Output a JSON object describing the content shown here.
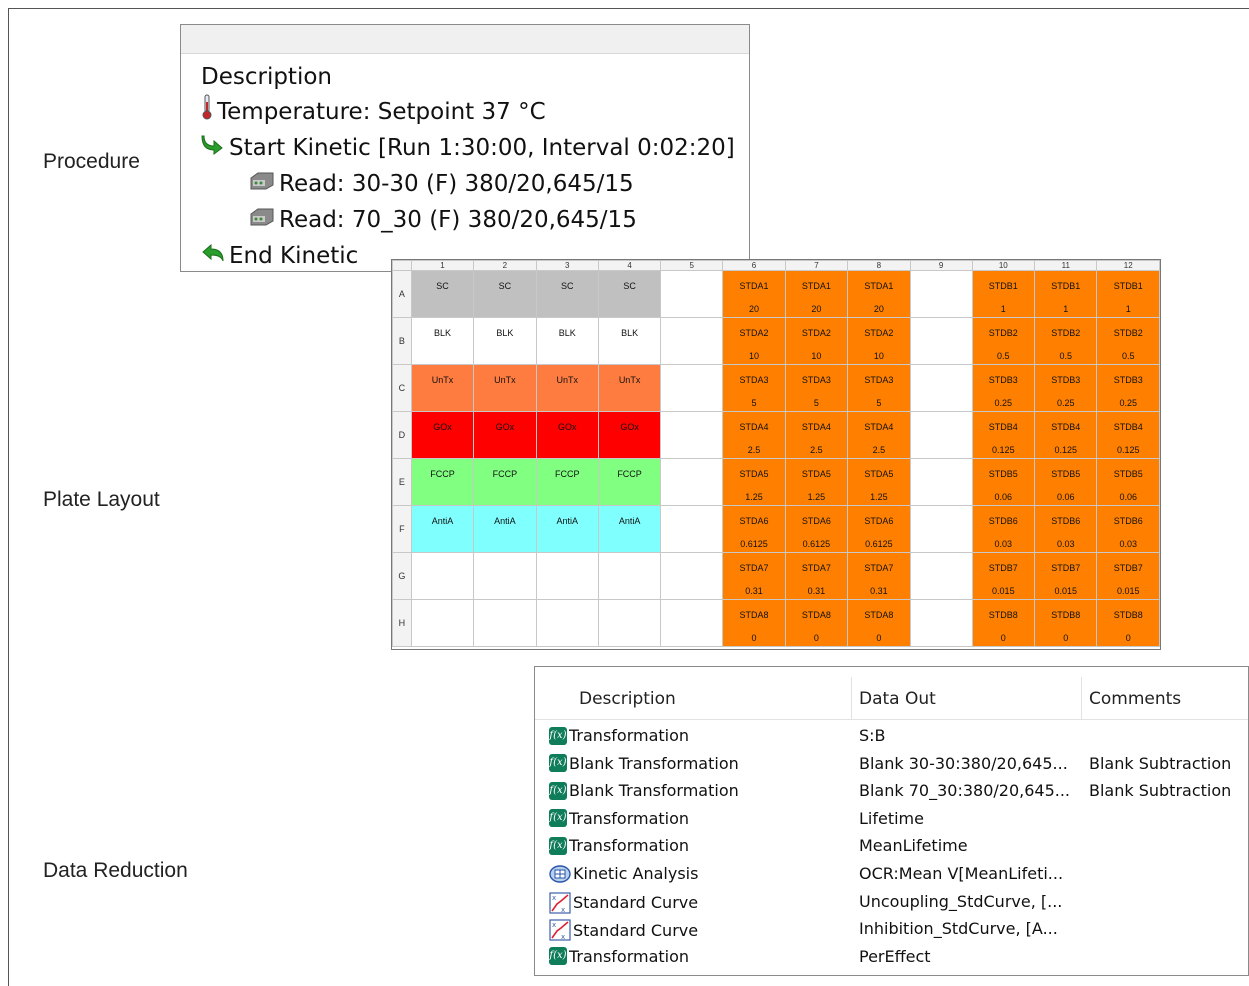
{
  "labels": {
    "procedure": "Procedure",
    "plate_layout": "Plate Layout",
    "data_reduction": "Data Reduction"
  },
  "procedure": {
    "header": "Description",
    "lines": [
      {
        "icon": "thermometer-icon",
        "text": "Temperature:  Setpoint 37 °C"
      },
      {
        "icon": "green-arrow-right-icon",
        "text": "Start Kinetic [Run 1:30:00, Interval 0:02:20]"
      },
      {
        "icon": "plate-reader-icon",
        "text": "Read:  30-30 (F) 380/20,645/15"
      },
      {
        "icon": "plate-reader-icon",
        "text": "Read:  70_30 (F) 380/20,645/15"
      },
      {
        "icon": "green-arrow-back-icon",
        "text": "End Kinetic"
      }
    ]
  },
  "plate": {
    "columns": [
      "1",
      "2",
      "3",
      "4",
      "5",
      "6",
      "7",
      "8",
      "9",
      "10",
      "11",
      "12"
    ],
    "colors": {
      "gray": "#c0c0c0",
      "white": "#ffffff",
      "salmon": "#ff7c41",
      "red": "#ff0000",
      "green": "#80ff80",
      "cyan": "#80ffff",
      "orange": "#ff8000"
    },
    "rows": [
      {
        "label": "A",
        "cells": [
          {
            "l1": "SC",
            "l2": "",
            "c": "gray"
          },
          {
            "l1": "SC",
            "l2": "",
            "c": "gray"
          },
          {
            "l1": "SC",
            "l2": "",
            "c": "gray"
          },
          {
            "l1": "SC",
            "l2": "",
            "c": "gray"
          },
          {
            "l1": "",
            "l2": "",
            "c": "white"
          },
          {
            "l1": "STDA1",
            "l2": "20",
            "c": "orange"
          },
          {
            "l1": "STDA1",
            "l2": "20",
            "c": "orange"
          },
          {
            "l1": "STDA1",
            "l2": "20",
            "c": "orange"
          },
          {
            "l1": "",
            "l2": "",
            "c": "white"
          },
          {
            "l1": "STDB1",
            "l2": "1",
            "c": "orange"
          },
          {
            "l1": "STDB1",
            "l2": "1",
            "c": "orange"
          },
          {
            "l1": "STDB1",
            "l2": "1",
            "c": "orange"
          }
        ]
      },
      {
        "label": "B",
        "cells": [
          {
            "l1": "BLK",
            "l2": "",
            "c": "white"
          },
          {
            "l1": "BLK",
            "l2": "",
            "c": "white"
          },
          {
            "l1": "BLK",
            "l2": "",
            "c": "white"
          },
          {
            "l1": "BLK",
            "l2": "",
            "c": "white"
          },
          {
            "l1": "",
            "l2": "",
            "c": "white"
          },
          {
            "l1": "STDA2",
            "l2": "10",
            "c": "orange"
          },
          {
            "l1": "STDA2",
            "l2": "10",
            "c": "orange"
          },
          {
            "l1": "STDA2",
            "l2": "10",
            "c": "orange"
          },
          {
            "l1": "",
            "l2": "",
            "c": "white"
          },
          {
            "l1": "STDB2",
            "l2": "0.5",
            "c": "orange"
          },
          {
            "l1": "STDB2",
            "l2": "0.5",
            "c": "orange"
          },
          {
            "l1": "STDB2",
            "l2": "0.5",
            "c": "orange"
          }
        ]
      },
      {
        "label": "C",
        "cells": [
          {
            "l1": "UnTx",
            "l2": "",
            "c": "salmon"
          },
          {
            "l1": "UnTx",
            "l2": "",
            "c": "salmon"
          },
          {
            "l1": "UnTx",
            "l2": "",
            "c": "salmon"
          },
          {
            "l1": "UnTx",
            "l2": "",
            "c": "salmon"
          },
          {
            "l1": "",
            "l2": "",
            "c": "white"
          },
          {
            "l1": "STDA3",
            "l2": "5",
            "c": "orange"
          },
          {
            "l1": "STDA3",
            "l2": "5",
            "c": "orange"
          },
          {
            "l1": "STDA3",
            "l2": "5",
            "c": "orange"
          },
          {
            "l1": "",
            "l2": "",
            "c": "white"
          },
          {
            "l1": "STDB3",
            "l2": "0.25",
            "c": "orange"
          },
          {
            "l1": "STDB3",
            "l2": "0.25",
            "c": "orange"
          },
          {
            "l1": "STDB3",
            "l2": "0.25",
            "c": "orange"
          }
        ]
      },
      {
        "label": "D",
        "cells": [
          {
            "l1": "GOx",
            "l2": "",
            "c": "red"
          },
          {
            "l1": "GOx",
            "l2": "",
            "c": "red"
          },
          {
            "l1": "GOx",
            "l2": "",
            "c": "red"
          },
          {
            "l1": "GOx",
            "l2": "",
            "c": "red"
          },
          {
            "l1": "",
            "l2": "",
            "c": "white"
          },
          {
            "l1": "STDA4",
            "l2": "2.5",
            "c": "orange"
          },
          {
            "l1": "STDA4",
            "l2": "2.5",
            "c": "orange"
          },
          {
            "l1": "STDA4",
            "l2": "2.5",
            "c": "orange"
          },
          {
            "l1": "",
            "l2": "",
            "c": "white"
          },
          {
            "l1": "STDB4",
            "l2": "0.125",
            "c": "orange"
          },
          {
            "l1": "STDB4",
            "l2": "0.125",
            "c": "orange"
          },
          {
            "l1": "STDB4",
            "l2": "0.125",
            "c": "orange"
          }
        ]
      },
      {
        "label": "E",
        "cells": [
          {
            "l1": "FCCP",
            "l2": "",
            "c": "green"
          },
          {
            "l1": "FCCP",
            "l2": "",
            "c": "green"
          },
          {
            "l1": "FCCP",
            "l2": "",
            "c": "green"
          },
          {
            "l1": "FCCP",
            "l2": "",
            "c": "green"
          },
          {
            "l1": "",
            "l2": "",
            "c": "white"
          },
          {
            "l1": "STDA5",
            "l2": "1.25",
            "c": "orange"
          },
          {
            "l1": "STDA5",
            "l2": "1.25",
            "c": "orange"
          },
          {
            "l1": "STDA5",
            "l2": "1.25",
            "c": "orange"
          },
          {
            "l1": "",
            "l2": "",
            "c": "white"
          },
          {
            "l1": "STDB5",
            "l2": "0.06",
            "c": "orange"
          },
          {
            "l1": "STDB5",
            "l2": "0.06",
            "c": "orange"
          },
          {
            "l1": "STDB5",
            "l2": "0.06",
            "c": "orange"
          }
        ]
      },
      {
        "label": "F",
        "cells": [
          {
            "l1": "AntiA",
            "l2": "",
            "c": "cyan"
          },
          {
            "l1": "AntiA",
            "l2": "",
            "c": "cyan"
          },
          {
            "l1": "AntiA",
            "l2": "",
            "c": "cyan"
          },
          {
            "l1": "AntiA",
            "l2": "",
            "c": "cyan"
          },
          {
            "l1": "",
            "l2": "",
            "c": "white"
          },
          {
            "l1": "STDA6",
            "l2": "0.6125",
            "c": "orange"
          },
          {
            "l1": "STDA6",
            "l2": "0.6125",
            "c": "orange"
          },
          {
            "l1": "STDA6",
            "l2": "0.6125",
            "c": "orange"
          },
          {
            "l1": "",
            "l2": "",
            "c": "white"
          },
          {
            "l1": "STDB6",
            "l2": "0.03",
            "c": "orange"
          },
          {
            "l1": "STDB6",
            "l2": "0.03",
            "c": "orange"
          },
          {
            "l1": "STDB6",
            "l2": "0.03",
            "c": "orange"
          }
        ]
      },
      {
        "label": "G",
        "cells": [
          {
            "l1": "",
            "l2": "",
            "c": "white"
          },
          {
            "l1": "",
            "l2": "",
            "c": "white"
          },
          {
            "l1": "",
            "l2": "",
            "c": "white"
          },
          {
            "l1": "",
            "l2": "",
            "c": "white"
          },
          {
            "l1": "",
            "l2": "",
            "c": "white"
          },
          {
            "l1": "STDA7",
            "l2": "0.31",
            "c": "orange"
          },
          {
            "l1": "STDA7",
            "l2": "0.31",
            "c": "orange"
          },
          {
            "l1": "STDA7",
            "l2": "0.31",
            "c": "orange"
          },
          {
            "l1": "",
            "l2": "",
            "c": "white"
          },
          {
            "l1": "STDB7",
            "l2": "0.015",
            "c": "orange"
          },
          {
            "l1": "STDB7",
            "l2": "0.015",
            "c": "orange"
          },
          {
            "l1": "STDB7",
            "l2": "0.015",
            "c": "orange"
          }
        ]
      },
      {
        "label": "H",
        "cells": [
          {
            "l1": "",
            "l2": "",
            "c": "white"
          },
          {
            "l1": "",
            "l2": "",
            "c": "white"
          },
          {
            "l1": "",
            "l2": "",
            "c": "white"
          },
          {
            "l1": "",
            "l2": "",
            "c": "white"
          },
          {
            "l1": "",
            "l2": "",
            "c": "white"
          },
          {
            "l1": "STDA8",
            "l2": "0",
            "c": "orange"
          },
          {
            "l1": "STDA8",
            "l2": "0",
            "c": "orange"
          },
          {
            "l1": "STDA8",
            "l2": "0",
            "c": "orange"
          },
          {
            "l1": "",
            "l2": "",
            "c": "white"
          },
          {
            "l1": "STDB8",
            "l2": "0",
            "c": "orange"
          },
          {
            "l1": "STDB8",
            "l2": "0",
            "c": "orange"
          },
          {
            "l1": "STDB8",
            "l2": "0",
            "c": "orange"
          }
        ]
      }
    ]
  },
  "data_reduction": {
    "headers": {
      "description": "Description",
      "data_out": "Data Out",
      "comments": "Comments"
    },
    "rows": [
      {
        "icon": "function-icon",
        "description": "Transformation",
        "data_out": "S:B",
        "comments": ""
      },
      {
        "icon": "function-icon",
        "description": "Blank Transformation",
        "data_out": "Blank 30-30:380/20,645...",
        "comments": "Blank Subtraction"
      },
      {
        "icon": "function-icon",
        "description": "Blank Transformation",
        "data_out": "Blank 70_30:380/20,645...",
        "comments": "Blank Subtraction"
      },
      {
        "icon": "function-icon",
        "description": "Transformation",
        "data_out": "Lifetime",
        "comments": ""
      },
      {
        "icon": "function-icon",
        "description": "Transformation",
        "data_out": "MeanLifetime",
        "comments": ""
      },
      {
        "icon": "kinetic-analysis-icon",
        "description": "Kinetic Analysis",
        "data_out": "OCR:Mean V[MeanLifeti...",
        "comments": ""
      },
      {
        "icon": "standard-curve-icon",
        "description": "Standard Curve",
        "data_out": "Uncoupling_StdCurve, [...",
        "comments": ""
      },
      {
        "icon": "standard-curve-icon",
        "description": "Standard Curve",
        "data_out": "Inhibition_StdCurve, [A...",
        "comments": ""
      },
      {
        "icon": "function-icon",
        "description": "Transformation",
        "data_out": "PerEffect",
        "comments": ""
      }
    ]
  }
}
